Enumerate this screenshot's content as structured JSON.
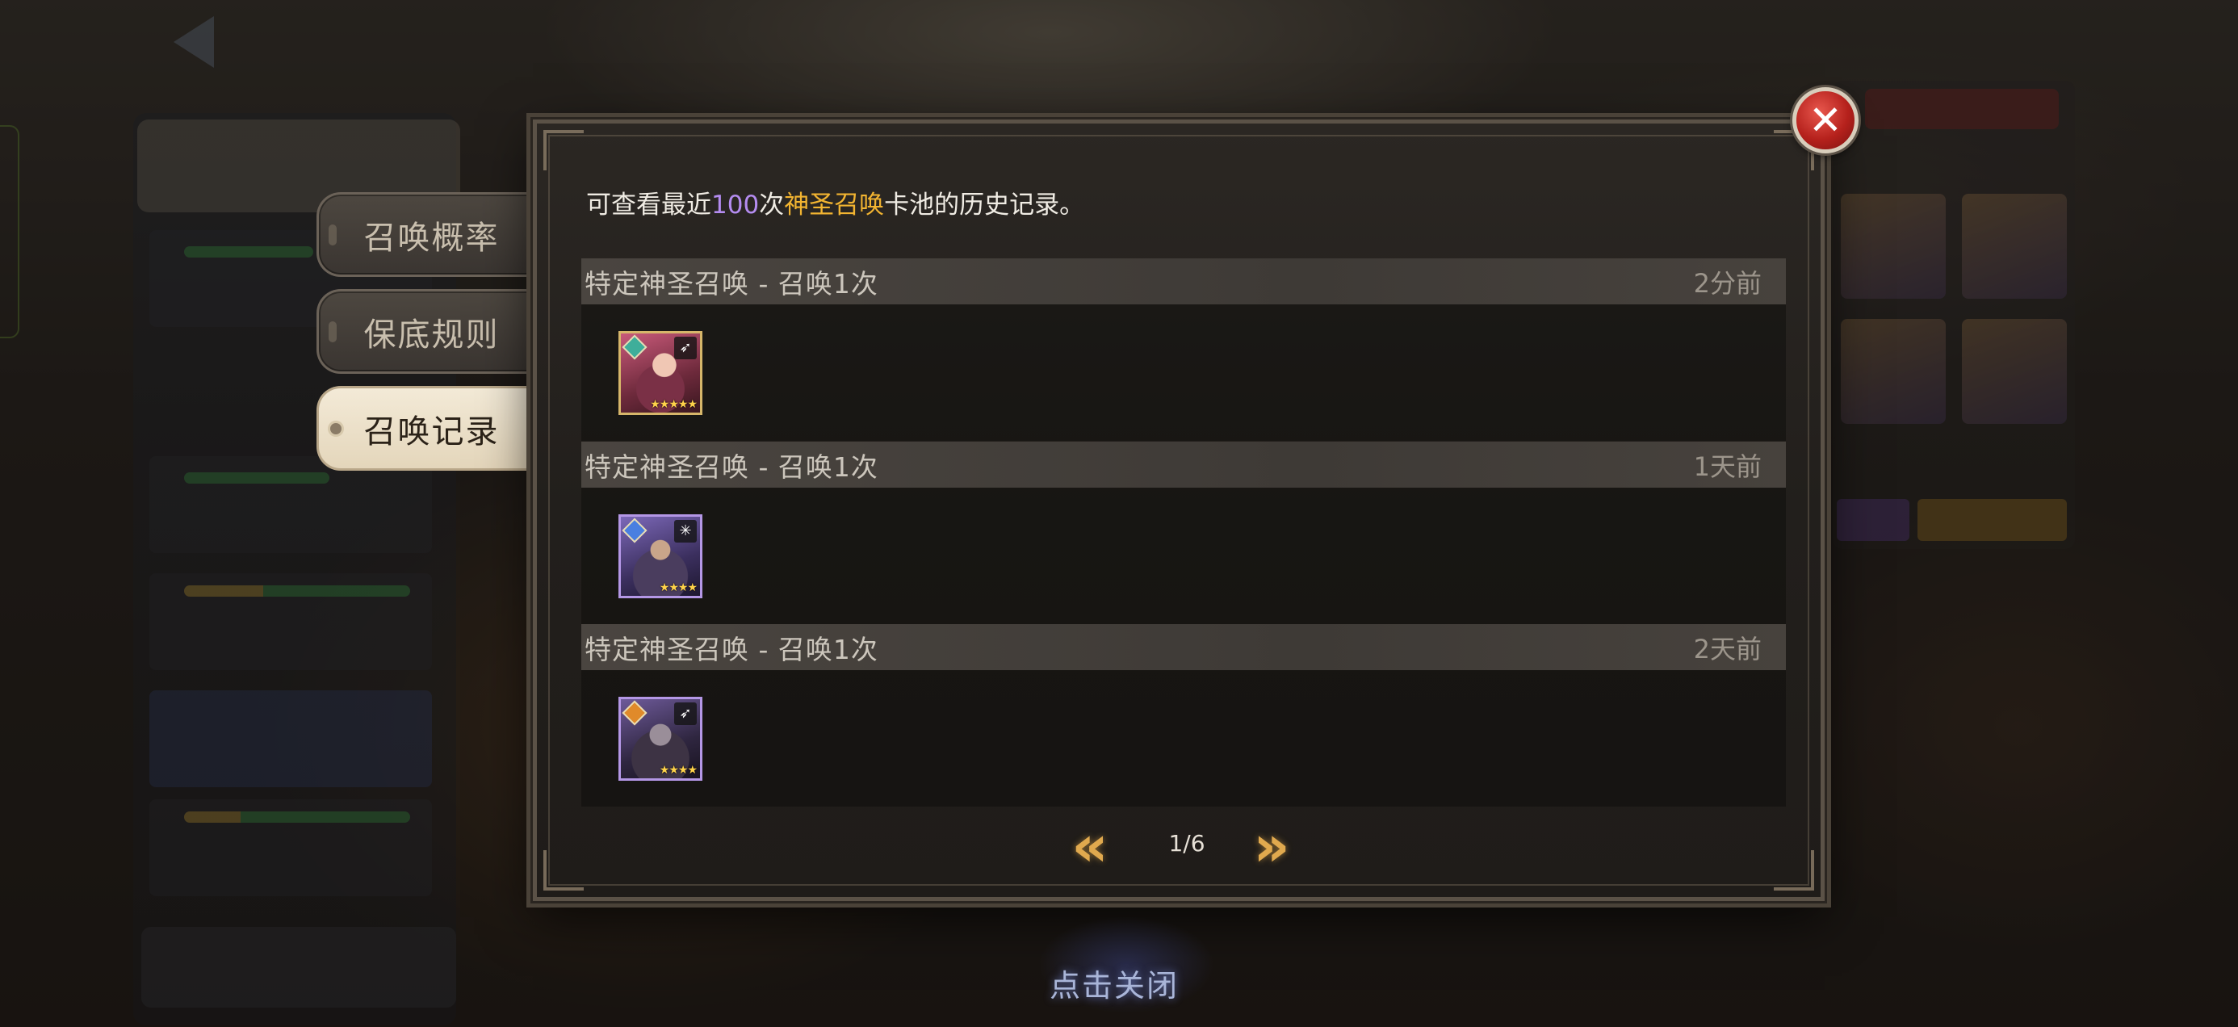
{
  "side_tabs": [
    {
      "label": "召唤概率",
      "active": false
    },
    {
      "label": "保底规则",
      "active": false
    },
    {
      "label": "召唤记录",
      "active": true
    }
  ],
  "info": {
    "prefix": "可查看最近",
    "count": "100",
    "middle": "次",
    "pool_name": "神圣召唤",
    "suffix": "卡池的历史记录。"
  },
  "records": [
    {
      "title": "特定神圣召唤 - 召唤1次",
      "time": "2分前",
      "hero": {
        "stars": "★★★★★",
        "star_count": 5,
        "rarity_border": "#d6b66a",
        "element_color": "#3fae9a",
        "class_icon": "bow-icon"
      }
    },
    {
      "title": "特定神圣召唤 - 召唤1次",
      "time": "1天前",
      "hero": {
        "stars": "★★★★",
        "star_count": 4,
        "rarity_border": "#b497e6",
        "element_color": "#4a7fe0",
        "class_icon": "mage-icon"
      }
    },
    {
      "title": "特定神圣召唤 - 召唤1次",
      "time": "2天前",
      "hero": {
        "stars": "★★★★",
        "star_count": 4,
        "rarity_border": "#b497e6",
        "element_color": "#e08a2a",
        "class_icon": "bow-icon"
      }
    }
  ],
  "pager": {
    "current": 1,
    "total": 6,
    "text": "1/6"
  },
  "tap_to_close": "点击关闭",
  "colors": {
    "highlight_purple": "#b48cf0",
    "highlight_gold": "#f2b431",
    "close_red": "#b5211c"
  }
}
